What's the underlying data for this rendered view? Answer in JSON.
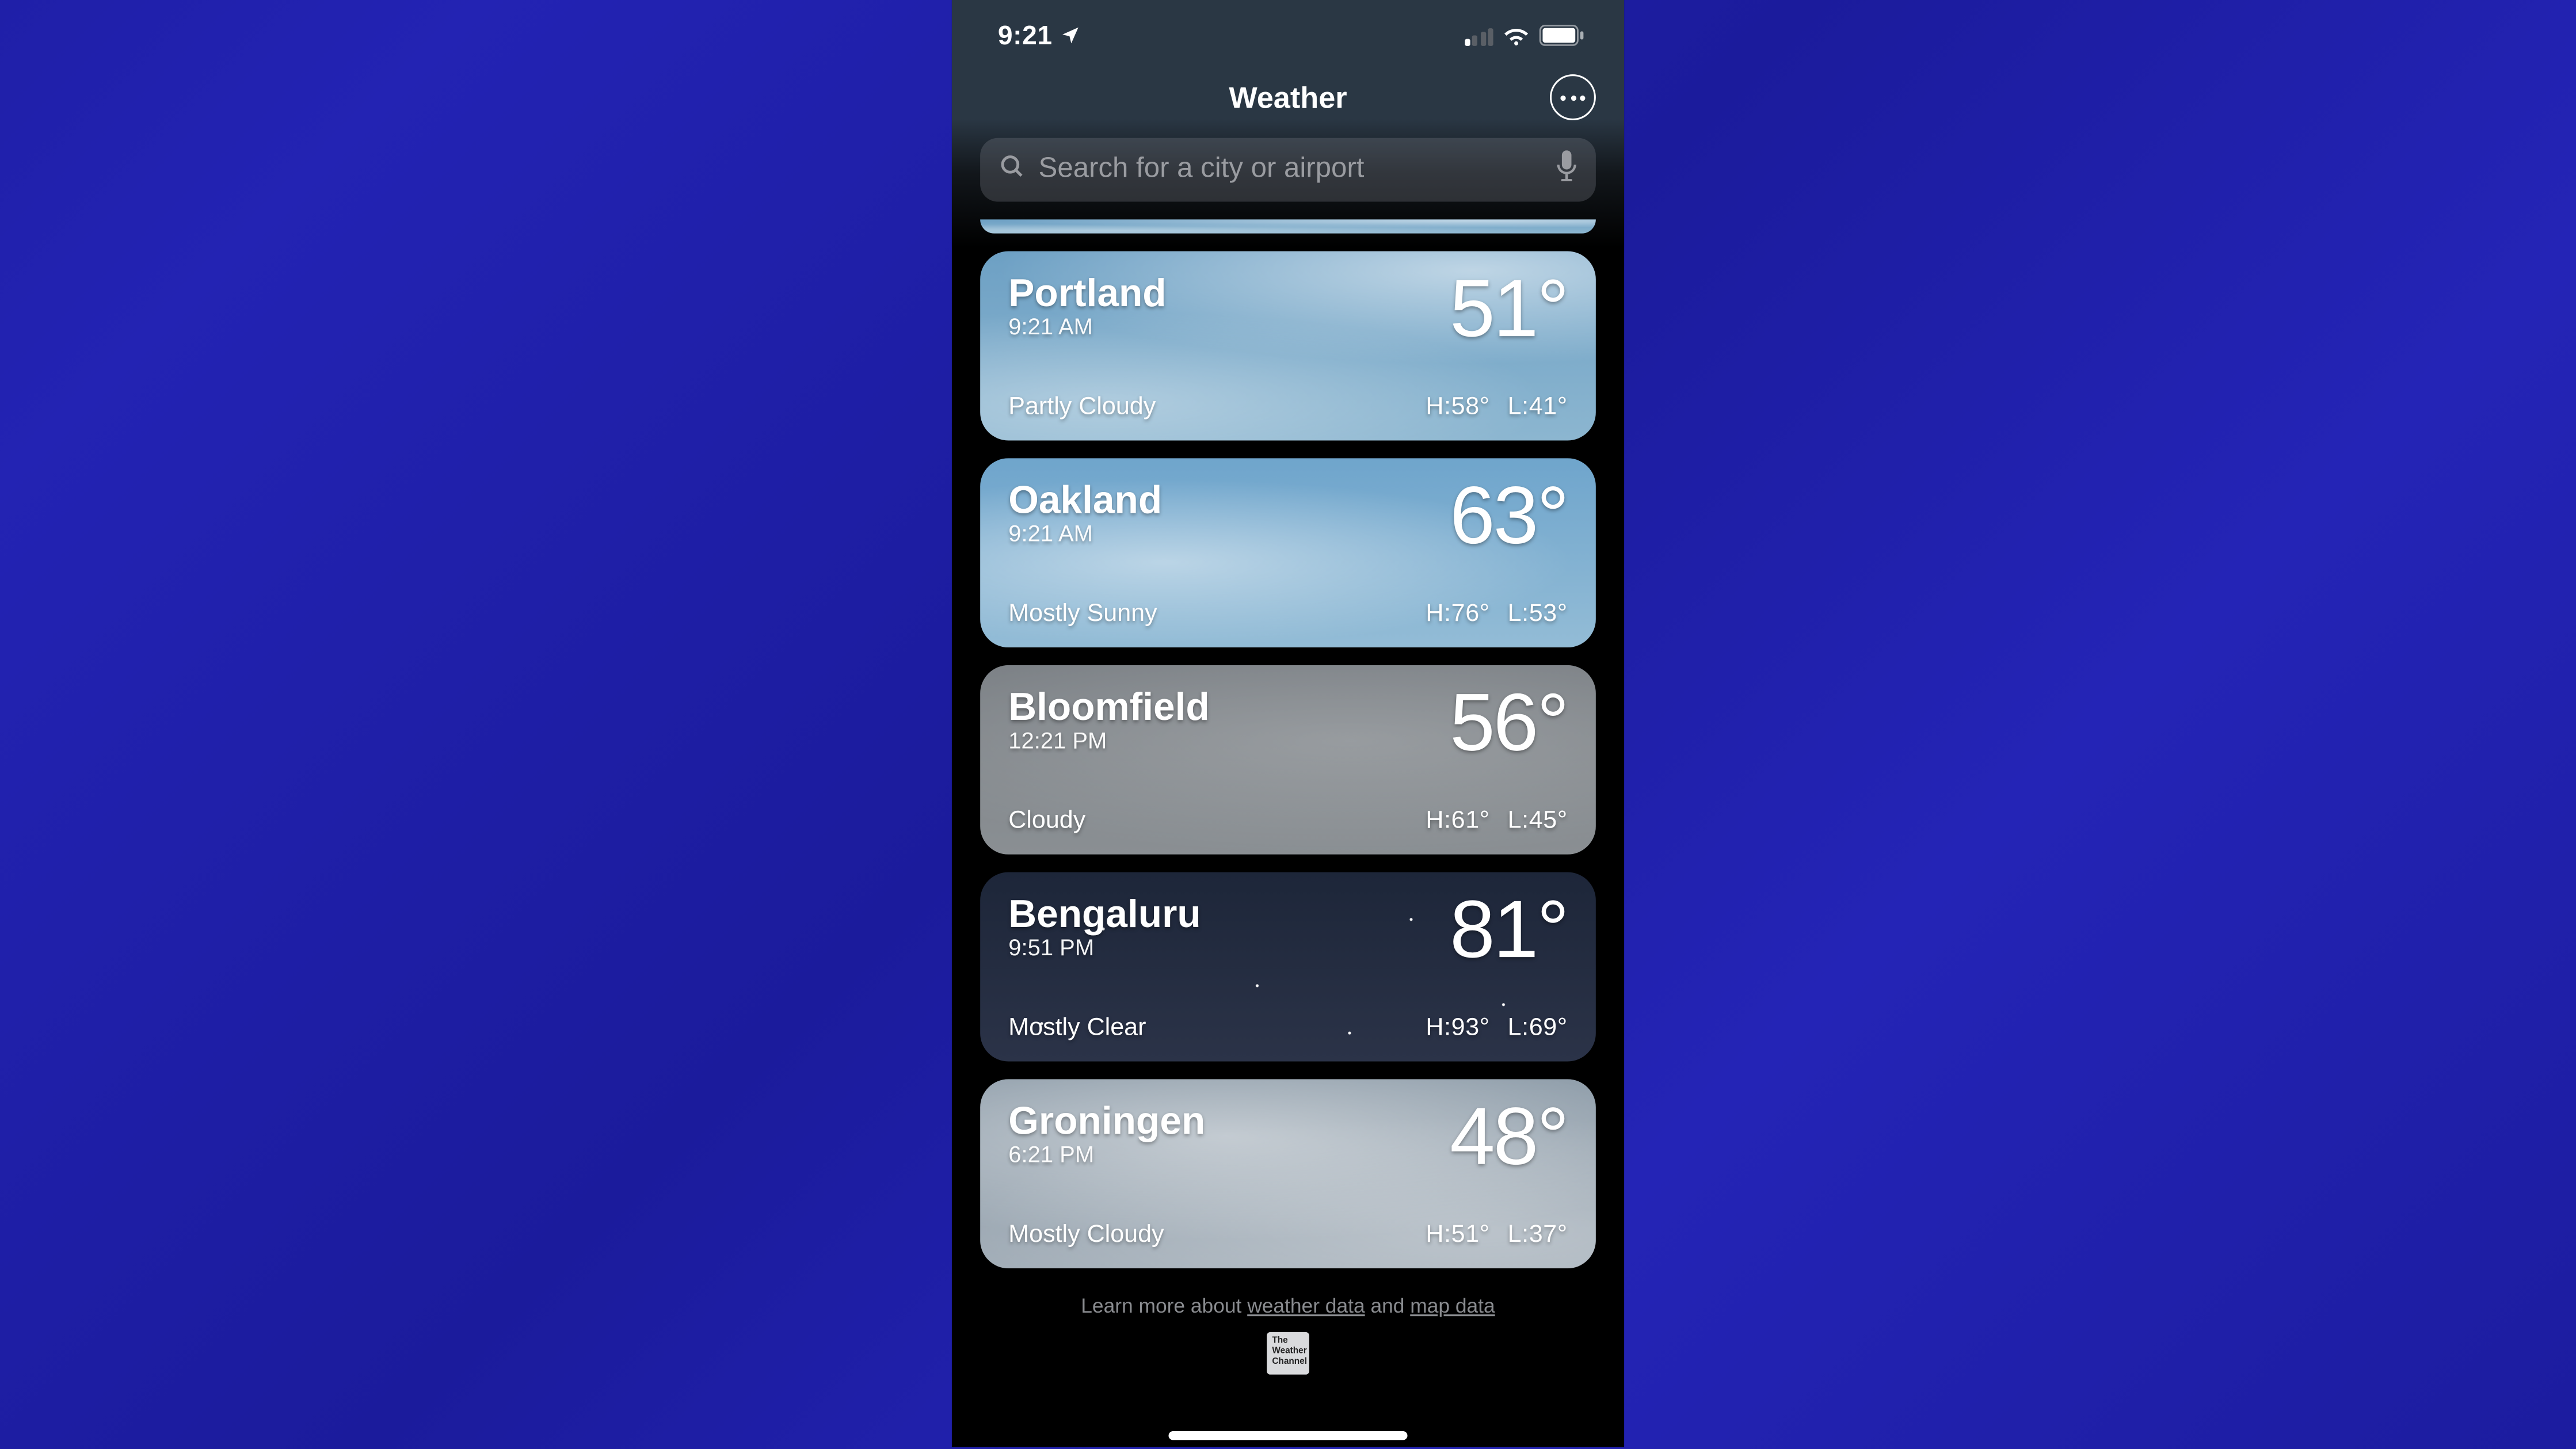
{
  "status_bar": {
    "time": "9:21",
    "location_arrow_icon": "location-arrow",
    "signal_icon": "cell-signal-1-of-4",
    "wifi_icon": "wifi",
    "battery_icon": "battery-full"
  },
  "header": {
    "title": "Weather",
    "more_button_icon": "ellipsis-circle"
  },
  "search": {
    "placeholder": "Search for a city or airport",
    "search_icon": "magnifying-glass",
    "mic_icon": "microphone",
    "value": ""
  },
  "cities": [
    {
      "name": "Portland",
      "local_time": "9:21 AM",
      "condition": "Partly Cloudy",
      "temp": "51°",
      "high": "H:58°",
      "low": "L:41°",
      "theme": "bg-partly-cloudy"
    },
    {
      "name": "Oakland",
      "local_time": "9:21 AM",
      "condition": "Mostly Sunny",
      "temp": "63°",
      "high": "H:76°",
      "low": "L:53°",
      "theme": "bg-sunny"
    },
    {
      "name": "Bloomfield",
      "local_time": "12:21 PM",
      "condition": "Cloudy",
      "temp": "56°",
      "high": "H:61°",
      "low": "L:45°",
      "theme": "bg-cloudy"
    },
    {
      "name": "Bengaluru",
      "local_time": "9:51 PM",
      "condition": "Mostly Clear",
      "temp": "81°",
      "high": "H:93°",
      "low": "L:69°",
      "theme": "bg-night"
    },
    {
      "name": "Groningen",
      "local_time": "6:21 PM",
      "condition": "Mostly Cloudy",
      "temp": "48°",
      "high": "H:51°",
      "low": "L:37°",
      "theme": "bg-mostly-cloudy"
    }
  ],
  "footer": {
    "prefix": "Learn more about ",
    "link1": "weather data",
    "mid": " and ",
    "link2": "map data",
    "twc_line1": "The",
    "twc_line2": "Weather",
    "twc_line3": "Channel"
  }
}
